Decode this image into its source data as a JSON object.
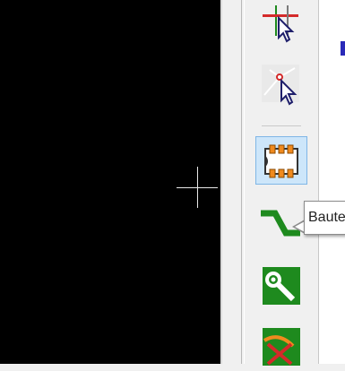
{
  "canvas": {
    "background": "#000000",
    "cursor": "crosshair-cursor"
  },
  "toolbar": {
    "tools": [
      {
        "name": "highlight-net-icon",
        "selected": false
      },
      {
        "name": "local-ratsnest-icon",
        "selected": false
      },
      {
        "name": "add-footprint-icon",
        "selected": true
      },
      {
        "name": "route-track-icon",
        "selected": false
      },
      {
        "name": "add-via-icon",
        "selected": false
      },
      {
        "name": "add-zone-icon",
        "selected": false
      }
    ]
  },
  "tooltip": {
    "text": "Bauteil"
  },
  "colors": {
    "selected_bg": "#cde6fa",
    "selected_border": "#7fb6e6",
    "accent_blue": "#2a2ab8",
    "track_green": "#1e8a1e"
  }
}
